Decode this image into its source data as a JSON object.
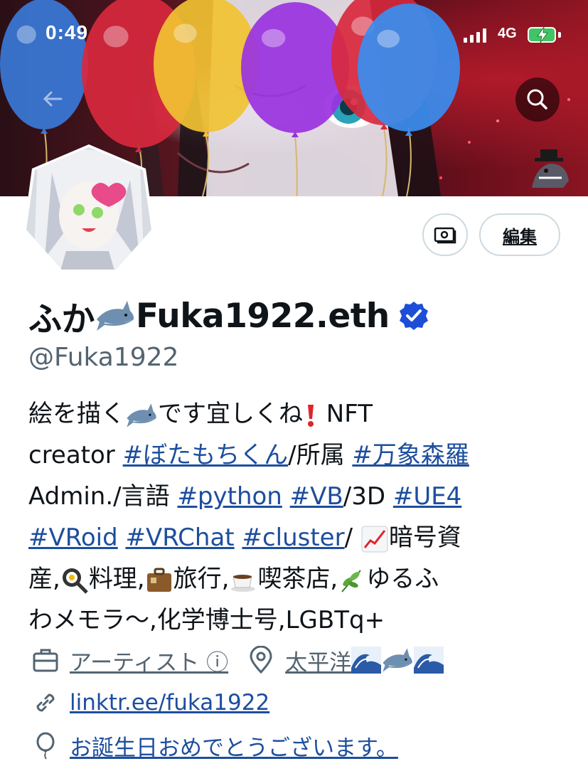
{
  "status_bar": {
    "time": "0:49",
    "network": "4G"
  },
  "banner": {
    "balloon_colors": [
      "#3a78d8",
      "#d8283e",
      "#f1c232",
      "#9a32e0",
      "#d8283e",
      "#3a8ef0"
    ]
  },
  "header": {
    "edit_label": "編集",
    "back_icon": "arrow-left-icon",
    "search_icon": "search-icon",
    "camera_icon": "camera-icon"
  },
  "profile": {
    "display_name_prefix": "ふか",
    "display_name_suffix": "Fuka1922.eth",
    "handle": "@Fuka1922",
    "verified": true
  },
  "bio": {
    "l1_a": "絵を描く",
    "l1_b": "です宜しくね",
    "l1_c": " NFT",
    "l2_a": "creator ",
    "l2_tag1": "#ぼたもちくん",
    "l2_b": "/所属 ",
    "l2_tag2": "#万象森羅",
    "l3_a": "Admin./言語 ",
    "l3_tag1": "#python",
    "l3_tag2": "#VB",
    "l3_b": "/3D ",
    "l3_tag3": "#UE4",
    "l4_tag1": "#VRoid",
    "l4_tag2": "#VRChat",
    "l4_tag3": "#cluster",
    "l4_b": "/ ",
    "l4_c": "暗号資",
    "l5_a": "産,",
    "l5_b": "料理,",
    "l5_c": "旅行,",
    "l5_d": "喫茶店,",
    "l5_e": "ゆるふ",
    "l6_a": "わメモラ〜,化学博士号,LGBTq+"
  },
  "meta": {
    "category": "アーティスト ⓘ",
    "location": "太平洋",
    "link": "linktr.ee/fuka1922",
    "birthday": "お誕生日おめでとうございます。"
  }
}
